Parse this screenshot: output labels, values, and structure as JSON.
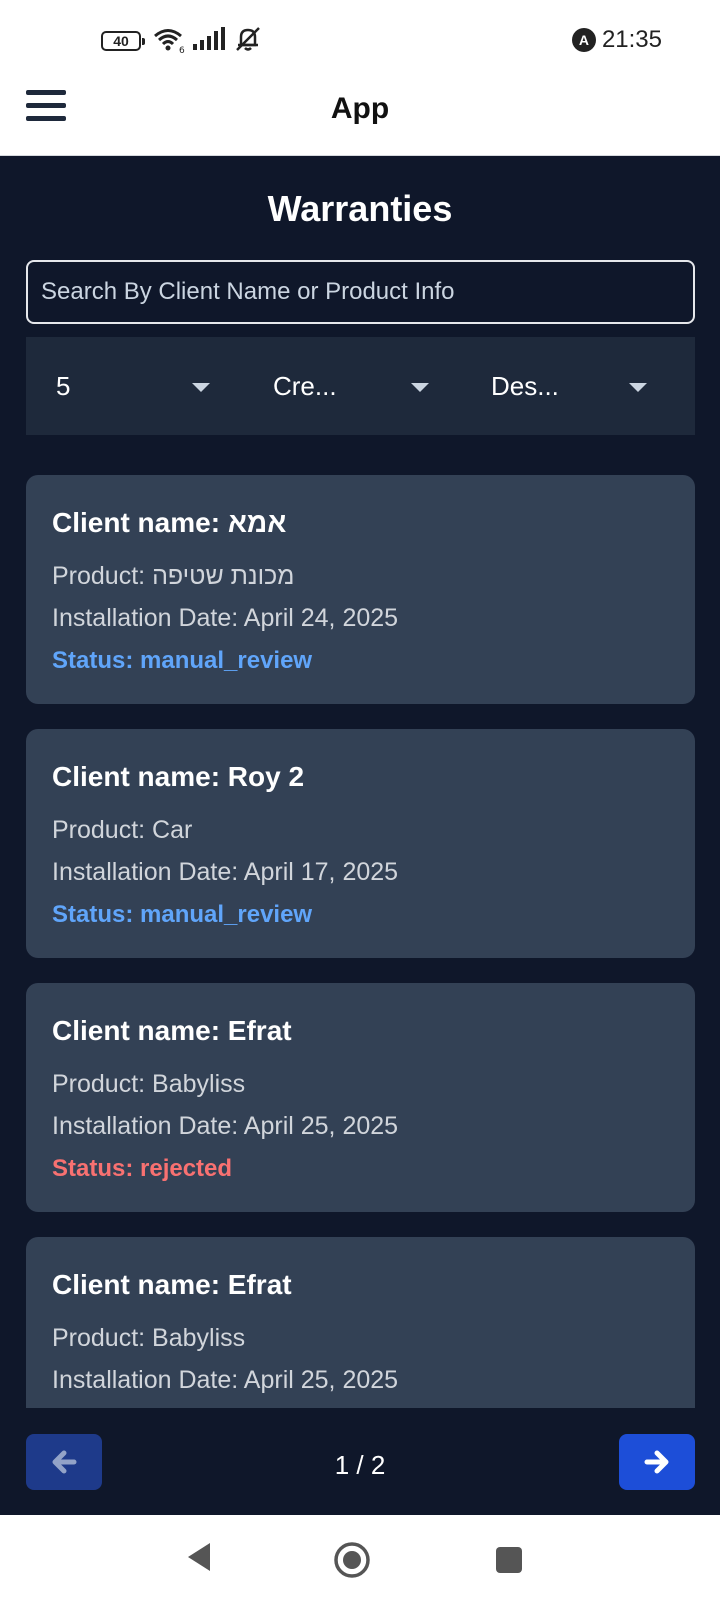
{
  "status_bar": {
    "battery": "40",
    "time": "21:35",
    "badge": "A"
  },
  "app_bar": {
    "title": "App"
  },
  "page": {
    "title": "Warranties"
  },
  "search": {
    "placeholder": "Search By Client Name or Product Info",
    "value": ""
  },
  "filters": {
    "page_size": "5",
    "sort_by": "Cre...",
    "order": "Des..."
  },
  "cards": [
    {
      "client": "Client name: אמא",
      "product": "Product: מכונת שטיפה",
      "date": "Installation Date: April 24, 2025",
      "status": "Status: manual_review",
      "status_color": "#60a5fa"
    },
    {
      "client": "Client name: Roy 2",
      "product": "Product: Car",
      "date": "Installation Date: April 17, 2025",
      "status": "Status: manual_review",
      "status_color": "#60a5fa"
    },
    {
      "client": "Client name: Efrat",
      "product": "Product: Babyliss",
      "date": "Installation Date: April 25, 2025",
      "status": "Status: rejected",
      "status_color": "#f87171"
    },
    {
      "client": "Client name: Efrat",
      "product": "Product: Babyliss",
      "date": "Installation Date: April 25, 2025"
    }
  ],
  "pagination": {
    "label": "1 / 2",
    "prev_icon": "arrow-left-icon",
    "next_icon": "arrow-right-icon"
  },
  "nav_bar": {
    "back_icon": "back-icon",
    "home_icon": "home-icon",
    "recents_icon": "recents-icon"
  }
}
